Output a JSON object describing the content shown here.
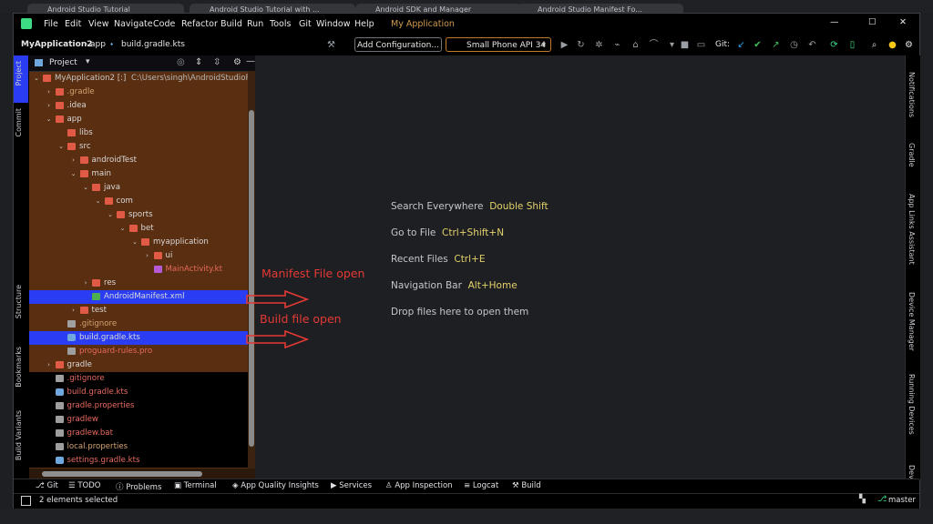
{
  "browser": {
    "tabs": [
      "Android Studio Tutorial",
      "Android Studio Tutorial with ...",
      "Android SDK and Manager",
      "Android Studio Manifest Fo..."
    ]
  },
  "menu": {
    "items": [
      "File",
      "Edit",
      "View",
      "Navigate",
      "Code",
      "Refactor",
      "Build",
      "Run",
      "Tools",
      "Git",
      "Window",
      "Help"
    ],
    "app_title": "My Application"
  },
  "window_controls": {
    "minimize": "—",
    "maximize": "☐",
    "close": "✕"
  },
  "toolbar": {
    "breadcrumb": [
      "MyApplication2",
      "app",
      "build.gradle.kts"
    ],
    "add_config": "Add Configuration...",
    "device": "Small Phone API 34",
    "git_label": "Git:"
  },
  "left_stripe": [
    "Project",
    "Commit",
    "Structure",
    "Bookmarks",
    "Build Variants"
  ],
  "right_stripe": [
    "Notifications",
    "Gradle",
    "App Links Assistant",
    "Device Manager",
    "Running Devices",
    "Dev"
  ],
  "panel": {
    "title": "Project",
    "tree": [
      {
        "depth": 0,
        "chev": "v",
        "icon": "folder",
        "label": "MyApplication2 [:]",
        "path": " C:\\Users\\singh\\AndroidStudioPro",
        "color": "dim"
      },
      {
        "depth": 1,
        "chev": ">",
        "icon": "folder",
        "label": ".gradle",
        "color": "orange"
      },
      {
        "depth": 1,
        "chev": ">",
        "icon": "folder",
        "label": ".idea"
      },
      {
        "depth": 1,
        "chev": "v",
        "icon": "folder",
        "label": "app"
      },
      {
        "depth": 2,
        "chev": "",
        "icon": "folder",
        "label": "libs"
      },
      {
        "depth": 2,
        "chev": "v",
        "icon": "folder",
        "label": "src"
      },
      {
        "depth": 3,
        "chev": ">",
        "icon": "folder",
        "label": "androidTest"
      },
      {
        "depth": 3,
        "chev": "v",
        "icon": "folder",
        "label": "main"
      },
      {
        "depth": 4,
        "chev": "v",
        "icon": "folder",
        "label": "java"
      },
      {
        "depth": 5,
        "chev": "v",
        "icon": "folder",
        "label": "com"
      },
      {
        "depth": 6,
        "chev": "v",
        "icon": "folder",
        "label": "sports"
      },
      {
        "depth": 7,
        "chev": "v",
        "icon": "folder",
        "label": "bet"
      },
      {
        "depth": 8,
        "chev": "v",
        "icon": "folder",
        "label": "myapplication"
      },
      {
        "depth": 9,
        "chev": ">",
        "icon": "folder",
        "label": "ui"
      },
      {
        "depth": 9,
        "chev": "",
        "icon": "kt",
        "label": "MainActivity.kt",
        "color": "red"
      },
      {
        "depth": 4,
        "chev": ">",
        "icon": "folder",
        "label": "res"
      },
      {
        "depth": 4,
        "chev": "",
        "icon": "xml",
        "label": "AndroidManifest.xml",
        "hl": true
      },
      {
        "depth": 3,
        "chev": ">",
        "icon": "folder",
        "label": "test"
      },
      {
        "depth": 2,
        "chev": "",
        "icon": "git",
        "label": ".gitignore",
        "color": "orange"
      },
      {
        "depth": 2,
        "chev": "",
        "icon": "gr",
        "label": "build.gradle.kts",
        "hl": true
      },
      {
        "depth": 2,
        "chev": "",
        "icon": "file",
        "label": "proguard-rules.pro",
        "color": "red"
      },
      {
        "depth": 1,
        "chev": ">",
        "icon": "folder",
        "label": "gradle"
      },
      {
        "depth": 1,
        "chev": "",
        "icon": "git",
        "label": ".gitignore",
        "color": "red",
        "black": true
      },
      {
        "depth": 1,
        "chev": "",
        "icon": "gr",
        "label": "build.gradle.kts",
        "color": "red",
        "black": true
      },
      {
        "depth": 1,
        "chev": "",
        "icon": "file",
        "label": "gradle.properties",
        "color": "red",
        "black": true
      },
      {
        "depth": 1,
        "chev": "",
        "icon": "file",
        "label": "gradlew",
        "color": "red",
        "black": true
      },
      {
        "depth": 1,
        "chev": "",
        "icon": "file",
        "label": "gradlew.bat",
        "color": "red",
        "black": true
      },
      {
        "depth": 1,
        "chev": "",
        "icon": "file",
        "label": "local.properties",
        "color": "orange",
        "black": true
      },
      {
        "depth": 1,
        "chev": "",
        "icon": "gr",
        "label": "settings.gradle.kts",
        "color": "red",
        "black": true
      }
    ]
  },
  "editor": {
    "hints": [
      {
        "action": "Search Everywhere",
        "key": "Double Shift"
      },
      {
        "action": "Go to File",
        "key": "Ctrl+Shift+N"
      },
      {
        "action": "Recent Files",
        "key": "Ctrl+E"
      },
      {
        "action": "Navigation Bar",
        "key": "Alt+Home"
      },
      {
        "action": "Drop files here to open them",
        "key": ""
      }
    ],
    "annotations": {
      "manifest": "Manifest File open",
      "build": "Build file open"
    }
  },
  "bottom_tools": [
    "Git",
    "TODO",
    "Problems",
    "Terminal",
    "App Quality Insights",
    "Services",
    "App Inspection",
    "Logcat",
    "Build"
  ],
  "status": {
    "left": "2 elements selected",
    "branch": "master"
  },
  "colors": {
    "highlight": "#2a3df2",
    "panel_bg": "#5a2e10",
    "annotation": "#e53935",
    "shortcut": "#e3d36b"
  }
}
